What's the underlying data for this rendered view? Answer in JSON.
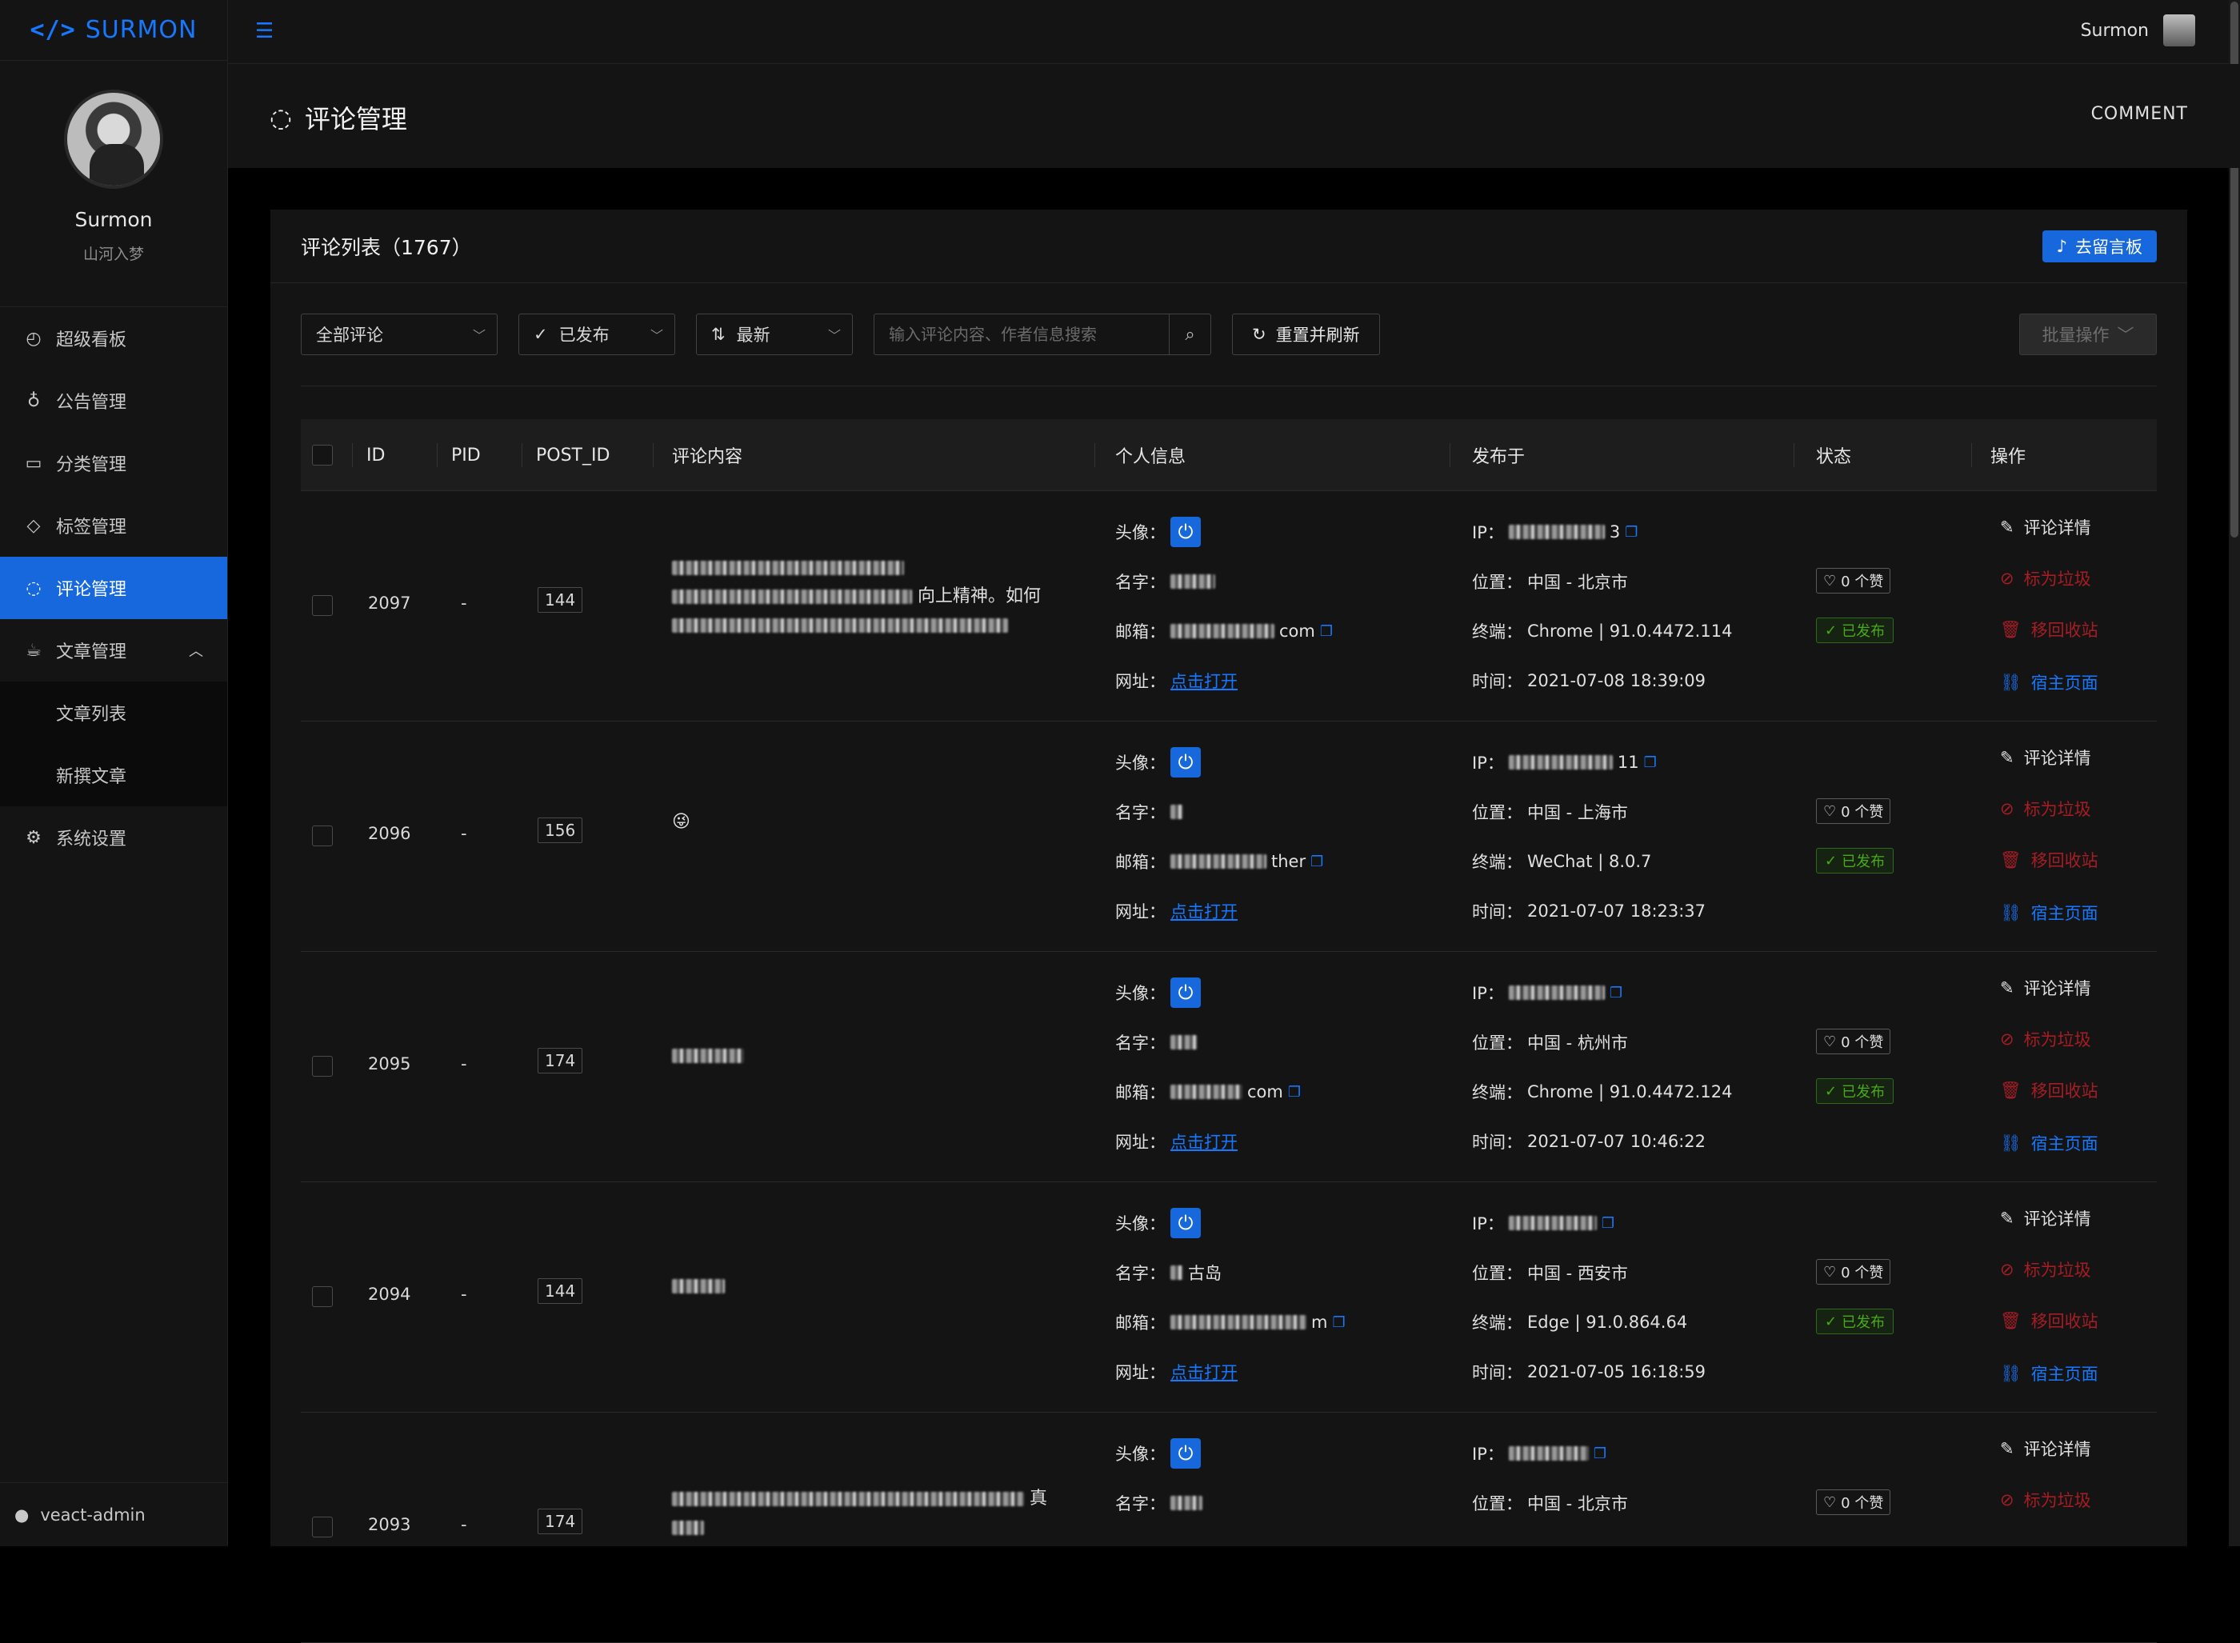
{
  "app": {
    "logo_glyph": "</>",
    "logo_text": "SURMON",
    "brand_color": "#1677ff"
  },
  "profile": {
    "name": "Surmon",
    "subtitle": "山河入梦"
  },
  "menu": [
    {
      "label": "超级看板",
      "icon": "dashboard-icon"
    },
    {
      "label": "公告管理",
      "icon": "bulb-icon"
    },
    {
      "label": "分类管理",
      "icon": "folder-icon"
    },
    {
      "label": "标签管理",
      "icon": "tag-icon"
    },
    {
      "label": "评论管理",
      "icon": "comment-icon",
      "active": true
    },
    {
      "label": "文章管理",
      "icon": "coffee-icon",
      "expanded": true
    },
    {
      "label": "文章列表",
      "sub": true
    },
    {
      "label": "新撰文章",
      "sub": true
    },
    {
      "label": "系统设置",
      "icon": "setting-icon"
    }
  ],
  "footer": {
    "label": "veact-admin",
    "icon": "github-icon"
  },
  "header": {
    "user": "Surmon"
  },
  "page": {
    "title": "评论管理",
    "en_title": "COMMENT"
  },
  "card": {
    "title": "评论列表（1767）",
    "board_button": "去留言板"
  },
  "filters": {
    "type": "全部评论",
    "status": "已发布",
    "sort": "最新",
    "search_placeholder": "输入评论内容、作者信息搜索",
    "refresh": "重置并刷新",
    "batch": "批量操作"
  },
  "columns": [
    "ID",
    "PID",
    "POST_ID",
    "评论内容",
    "个人信息",
    "发布于",
    "状态",
    "操作"
  ],
  "labels": {
    "avatar": "头像：",
    "name": "名字：",
    "email": "邮箱：",
    "site": "网址：",
    "open": "点击打开",
    "ip": "IP：",
    "location": "位置：",
    "terminal": "终端：",
    "time": "时间："
  },
  "actions": {
    "detail": "评论详情",
    "spam": "标为垃圾",
    "trash": "移回收站",
    "host": "宿主页面"
  },
  "rows": [
    {
      "id": "2097",
      "pid": "-",
      "post_id": "144",
      "content": "向上精神。如何",
      "name": "",
      "email_tail": "com",
      "ip_tail": "3",
      "location": "中国 - 北京市",
      "terminal": "Chrome | 91.0.4472.114",
      "time": "2021-07-08 18:39:09",
      "likes": "0 个赞",
      "status": "已发布"
    },
    {
      "id": "2096",
      "pid": "-",
      "post_id": "156",
      "content": "😜",
      "name": "",
      "email_tail": "ther",
      "ip_tail": "11",
      "location": "中国 - 上海市",
      "terminal": "WeChat | 8.0.7",
      "time": "2021-07-07 18:23:37",
      "likes": "0 个赞",
      "status": "已发布"
    },
    {
      "id": "2095",
      "pid": "-",
      "post_id": "174",
      "content": "",
      "name": "",
      "email_tail": "com",
      "ip_tail": "",
      "location": "中国 - 杭州市",
      "terminal": "Chrome | 91.0.4472.124",
      "time": "2021-07-07 10:46:22",
      "likes": "0 个赞",
      "status": "已发布"
    },
    {
      "id": "2094",
      "pid": "-",
      "post_id": "144",
      "content": "",
      "name": "古岛",
      "email_tail": "m",
      "ip_tail": "",
      "location": "中国 - 西安市",
      "terminal": "Edge | 91.0.864.64",
      "time": "2021-07-05 16:18:59",
      "likes": "0 个赞",
      "status": "已发布"
    },
    {
      "id": "2093",
      "pid": "-",
      "post_id": "174",
      "content": "真",
      "name": "",
      "email_tail": "",
      "ip_tail": "",
      "location": "中国 - 北京市",
      "terminal": "",
      "time": "",
      "likes": "0 个赞",
      "status": ""
    }
  ],
  "colors": {
    "accent": "#1668dc",
    "success": "#49aa19",
    "danger": "#a61d24",
    "bg": "#141414"
  }
}
